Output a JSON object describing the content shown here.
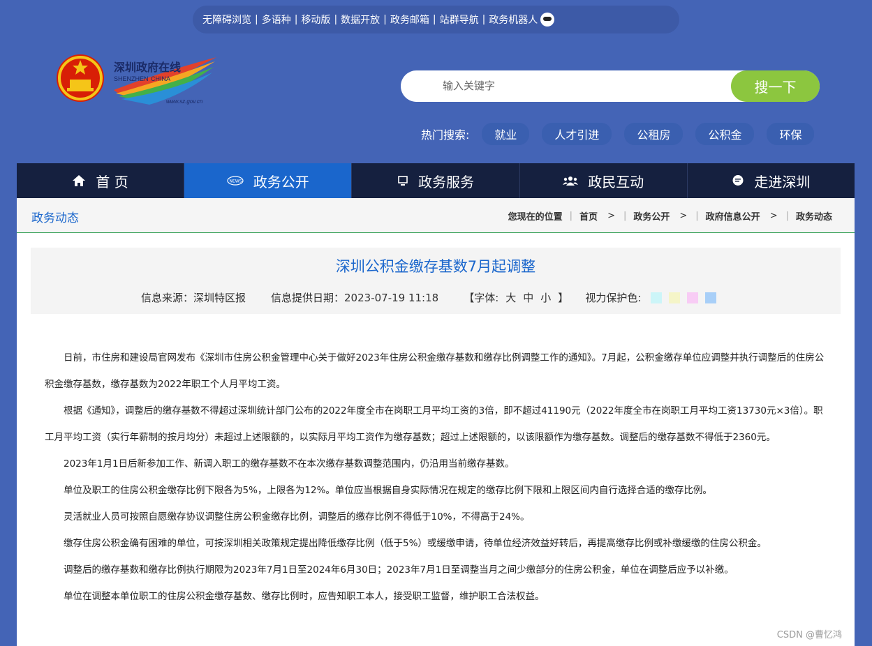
{
  "topbar": {
    "links": [
      "无障碍浏览",
      "多语种",
      "移动版",
      "数据开放",
      "政务邮箱",
      "站群导航",
      "政务机器人"
    ]
  },
  "logo": {
    "cn": "深圳政府在线",
    "en1": "SHENZHEN",
    "en2": "CHINA",
    "url": "www.sz.gov.cn"
  },
  "search": {
    "placeholder": "输入关键字",
    "button": "搜一下"
  },
  "hot": {
    "label": "热门搜索:",
    "tags": [
      "就业",
      "人才引进",
      "公租房",
      "公积金",
      "环保"
    ]
  },
  "nav": {
    "items": [
      "首 页",
      "政务公开",
      "政务服务",
      "政民互动",
      "走进深圳"
    ],
    "active": 1
  },
  "crumbbar": {
    "title": "政务动态",
    "location_label": "您现在的位置",
    "path": [
      "首页",
      "政务公开",
      "政府信息公开",
      "政务动态"
    ]
  },
  "article": {
    "title": "深圳公积金缴存基数7月起调整",
    "source": "信息来源：深圳特区报",
    "date": "信息提供日期：2023-07-19 11:18",
    "font_label": "【字体:",
    "font_sizes": [
      "大",
      "中",
      "小"
    ],
    "font_close": "】",
    "eye_label": "视力保护色:",
    "eye_colors": [
      "#ccf5f8",
      "#f5f5c8",
      "#f8ccf5",
      "#a8cff8"
    ],
    "paragraphs": [
      "日前，市住房和建设局官网发布《深圳市住房公积金管理中心关于做好2023年住房公积金缴存基数和缴存比例调整工作的通知》。7月起，公积金缴存单位应调整并执行调整后的住房公积金缴存基数，缴存基数为2022年职工个人月平均工资。",
      "根据《通知》，调整后的缴存基数不得超过深圳统计部门公布的2022年度全市在岗职工月平均工资的3倍，即不超过41190元（2022年度全市在岗职工月平均工资13730元×3倍）。职工月平均工资（实行年薪制的按月均分）未超过上述限额的，以实际月平均工资作为缴存基数；超过上述限额的，以该限额作为缴存基数。调整后的缴存基数不得低于2360元。",
      "2023年1月1日后新参加工作、新调入职工的缴存基数不在本次缴存基数调整范围内，仍沿用当前缴存基数。",
      "单位及职工的住房公积金缴存比例下限各为5%，上限各为12%。单位应当根据自身实际情况在规定的缴存比例下限和上限区间内自行选择合适的缴存比例。",
      "灵活就业人员可按照自愿缴存协议调整住房公积金缴存比例，调整后的缴存比例不得低于10%，不得高于24%。",
      "缴存住房公积金确有困难的单位，可按深圳相关政策规定提出降低缴存比例（低于5%）或缓缴申请，待单位经济效益好转后，再提高缴存比例或补缴缓缴的住房公积金。",
      "调整后的缴存基数和缴存比例执行期限为2023年7月1日至2024年6月30日；2023年7月1日至调整当月之间少缴部分的住房公积金，单位在调整后应予以补缴。",
      "单位在调整本单位职工的住房公积金缴存基数、缴存比例时，应告知职工本人，接受职工监督，维护职工合法权益。"
    ]
  },
  "watermark": "CSDN @曹忆鸿"
}
